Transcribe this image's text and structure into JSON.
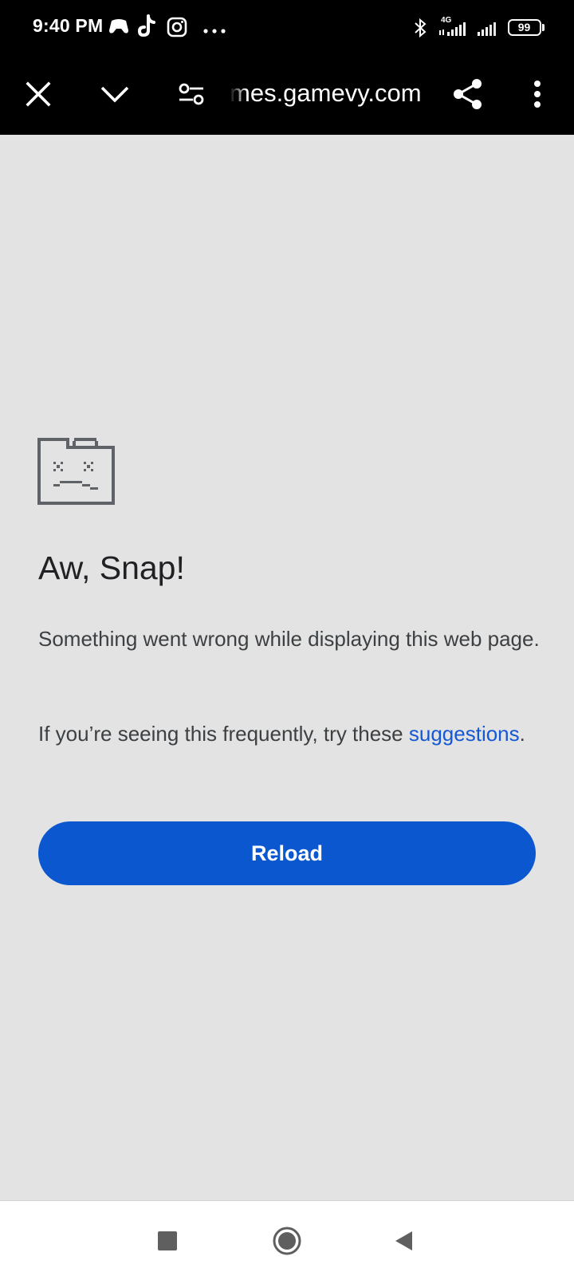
{
  "status_bar": {
    "time": "9:40 PM",
    "battery": "99",
    "network_label": "4G",
    "icons": [
      "game-controller-icon",
      "tiktok-icon",
      "instagram-icon",
      "more-notifications-icon",
      "bluetooth-icon",
      "signal-4g-icon",
      "signal-icon",
      "battery-icon"
    ]
  },
  "toolbar": {
    "url": "mes.gamevy.com",
    "icons": [
      "close-icon",
      "chevron-down-icon",
      "site-settings-icon",
      "share-icon",
      "more-vert-icon"
    ]
  },
  "error": {
    "heading": "Aw, Snap!",
    "message": "Something went wrong while displaying this web page.",
    "suggest_prefix": "If you’re seeing this frequently, try these ",
    "suggest_link": "suggestions",
    "suggest_suffix": ".",
    "reload_label": "Reload"
  },
  "nav_bar": {
    "icons": [
      "recents-icon",
      "home-icon",
      "back-icon"
    ]
  },
  "colors": {
    "page_background": "#e3e3e3",
    "bars_background": "#000000",
    "primary_button": "#0b57d0",
    "link": "#1558d6",
    "heading_text": "#202124",
    "body_text": "#3c4043"
  }
}
